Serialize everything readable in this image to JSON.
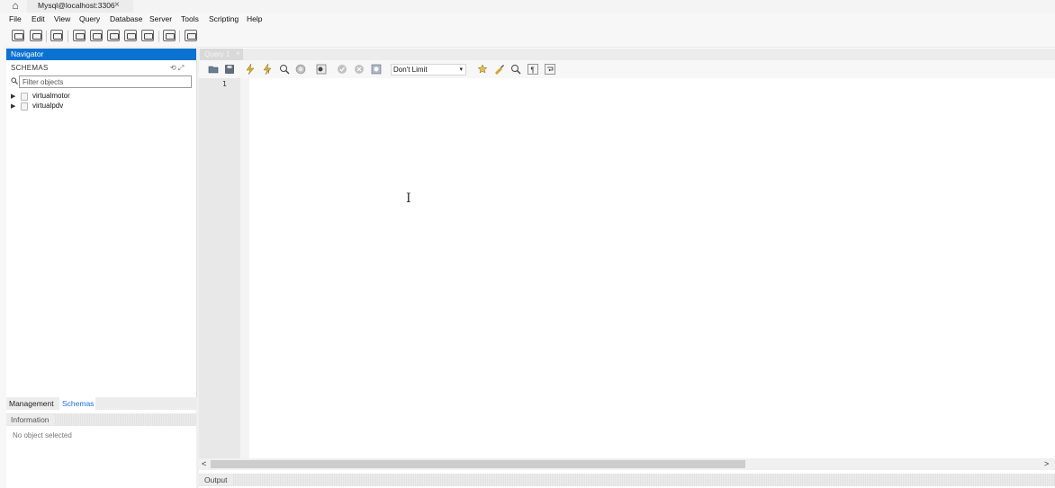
{
  "window": {
    "home_icon": "⌂",
    "connection_tab": "Mysql@localhost:3306",
    "close_glyph": "×"
  },
  "menu": [
    "File",
    "Edit",
    "View",
    "Query",
    "Database",
    "Server",
    "Tools",
    "Scripting",
    "Help"
  ],
  "toolbar_icons": [
    "new-sql-tab-icon",
    "open-sql-script-icon",
    "inspect-icon",
    "create-schema-icon",
    "create-table-icon",
    "create-view-icon",
    "create-procedure-icon",
    "create-function-icon",
    "search-table-data-icon",
    "reconnect-icon"
  ],
  "navigator": {
    "header": "Navigator",
    "schemas_label": "SCHEMAS",
    "filter_placeholder": "Filter objects",
    "search_glyph": "🔍",
    "tools_glyph": "⟲ ⤢",
    "schemas": [
      {
        "name": "virtualmotor"
      },
      {
        "name": "virtualpdv"
      }
    ],
    "tabs": {
      "management": "Management",
      "schemas": "Schemas"
    },
    "info_label": "Information",
    "no_object": "No object selected"
  },
  "query": {
    "tab_label": "Query 1",
    "tab_close": "×",
    "limit_value": "Don't Limit",
    "caret": "▾",
    "line_number": "1",
    "cursor_glyph": "I"
  },
  "scroll": {
    "left": "<",
    "right": ">"
  },
  "output": {
    "label": "Output"
  },
  "colors": {
    "accent": "#0a72d1",
    "tab_active_text": "#1a6fd6"
  }
}
